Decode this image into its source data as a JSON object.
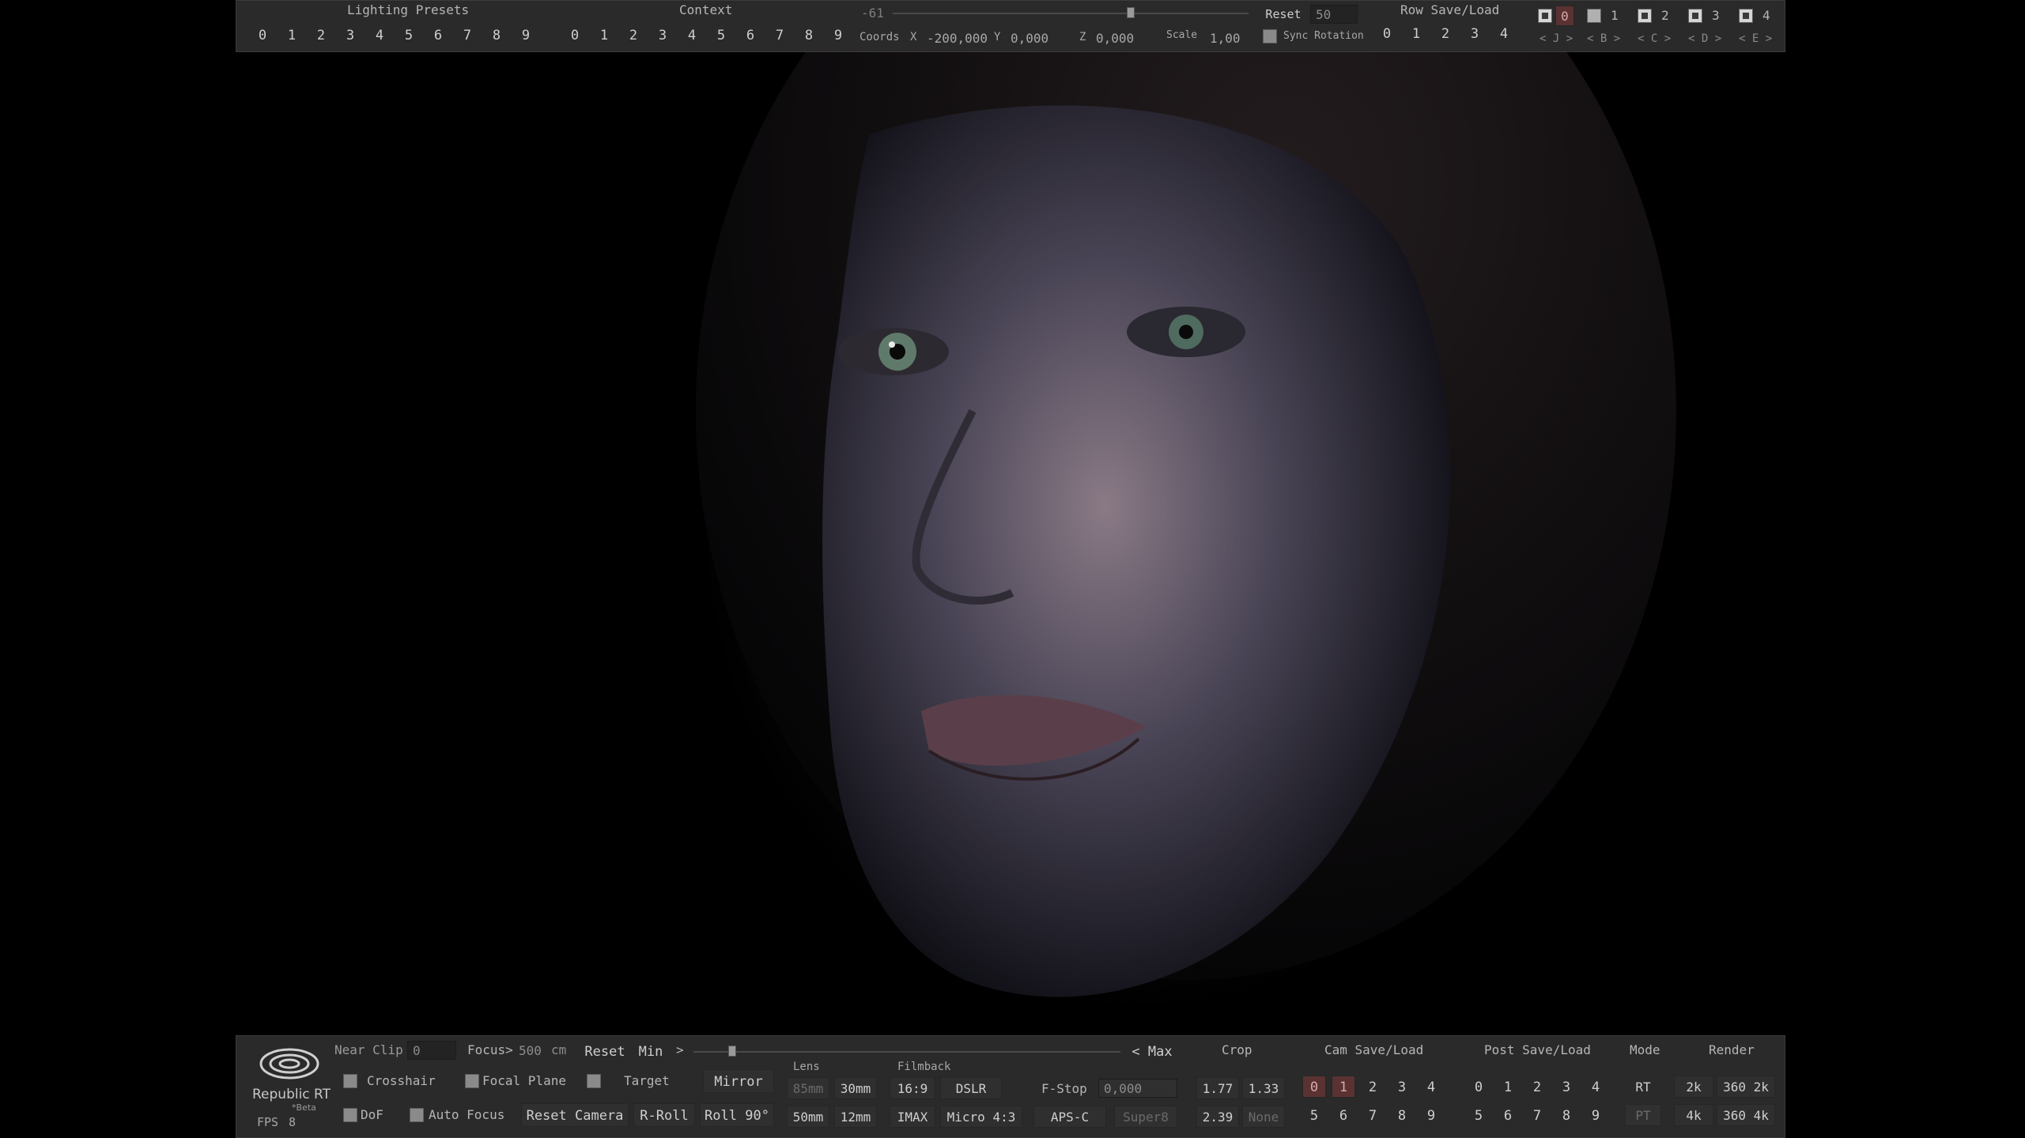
{
  "top": {
    "lighting_presets": {
      "label": "Lighting Presets",
      "buttons": [
        "0",
        "1",
        "2",
        "3",
        "4",
        "5",
        "6",
        "7",
        "8",
        "9"
      ]
    },
    "context": {
      "label": "Context",
      "buttons": [
        "0",
        "1",
        "2",
        "3",
        "4",
        "5",
        "6",
        "7",
        "8",
        "9"
      ]
    },
    "rotation_value": "-61",
    "coords_label": "Coords",
    "x_label": "X",
    "x_value": "-200,000",
    "y_label": "Y",
    "y_value": "0,000",
    "z_label": "Z",
    "z_value": "0,000",
    "scale_label": "Scale",
    "scale_value": "1,00",
    "reset_label": "Reset",
    "reset_value": "50",
    "sync_rotation_label": "Sync Rotation",
    "row_save_load": {
      "label": "Row Save/Load",
      "buttons": [
        "0",
        "1",
        "2",
        "3",
        "4"
      ]
    },
    "rows": [
      {
        "num": "0",
        "nav": "< J >"
      },
      {
        "num": "1",
        "nav": "< B >"
      },
      {
        "num": "2",
        "nav": "< C >"
      },
      {
        "num": "3",
        "nav": "< D >"
      },
      {
        "num": "4",
        "nav": "< E >"
      }
    ]
  },
  "bottom": {
    "logo_name": "Republic RT",
    "logo_sub": "*Beta",
    "fps_label": "FPS",
    "fps_value": "8",
    "near_clip_label": "Near Clip",
    "near_clip_value": "0",
    "focus_label": "Focus>",
    "focus_value": "500",
    "focus_unit": "cm",
    "reset_label": "Reset",
    "min_label": "Min",
    "min_arrow": ">",
    "max_label": "< Max",
    "crosshair_label": "Crosshair",
    "focal_plane_label": "Focal Plane",
    "target_label": "Target",
    "mirror_label": "Mirror",
    "dof_label": "DoF",
    "auto_focus_label": "Auto Focus",
    "reset_camera_label": "Reset Camera",
    "rroll_label": "R-Roll",
    "roll90_label": "Roll 90°",
    "lens": {
      "label": "Lens",
      "buttons": [
        "85mm",
        "30mm",
        "50mm",
        "12mm"
      ]
    },
    "filmback": {
      "label": "Filmback",
      "buttons": [
        "16:9",
        "DSLR",
        "IMAX",
        "Micro 4:3",
        "APS-C",
        "Super8"
      ]
    },
    "fstop_label": "F-Stop",
    "fstop_value": "0,000",
    "crop": {
      "label": "Crop",
      "buttons": [
        "1.77",
        "1.33",
        "2.39",
        "None"
      ]
    },
    "cam_save_load": {
      "label": "Cam Save/Load",
      "buttons": [
        "0",
        "1",
        "2",
        "3",
        "4",
        "5",
        "6",
        "7",
        "8",
        "9"
      ]
    },
    "post_save_load": {
      "label": "Post Save/Load",
      "buttons": [
        "0",
        "1",
        "2",
        "3",
        "4",
        "5",
        "6",
        "7",
        "8",
        "9"
      ]
    },
    "mode": {
      "label": "Mode",
      "buttons": [
        "RT",
        "PT"
      ]
    },
    "render": {
      "label": "Render",
      "buttons": [
        "2k",
        "360 2k",
        "4k",
        "360 4k"
      ]
    }
  },
  "colors": {
    "panel": "#2a2a2a",
    "active_red": "#5a3232",
    "text": "#cfcfcf"
  }
}
